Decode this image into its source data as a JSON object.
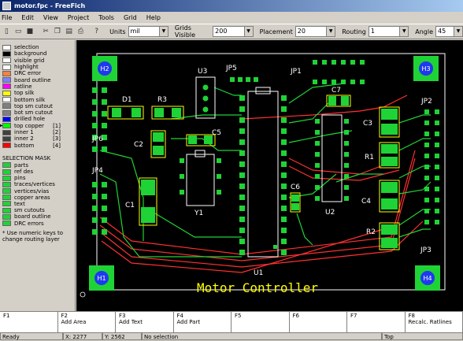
{
  "window": {
    "title": "motor.fpc - FreeFich"
  },
  "menu": [
    "File",
    "Edit",
    "View",
    "Project",
    "Tools",
    "Grid",
    "Help"
  ],
  "toolbar": {
    "units_label": "Units",
    "units_value": "mil",
    "grid_label": "Grids Visible",
    "grid_value": "200",
    "placement_label": "Placement",
    "placement_value": "20",
    "routing_label": "Routing",
    "routing_value": "1",
    "angle_label": "Angle",
    "angle_value": "45"
  },
  "layers": [
    {
      "label": "selection",
      "color": "#ffffff"
    },
    {
      "label": "background",
      "color": "#000000"
    },
    {
      "label": "visible grid",
      "color": "#ffffff"
    },
    {
      "label": "highlight",
      "color": "#ffffff"
    },
    {
      "label": "DRC error",
      "color": "#ff8040"
    },
    {
      "label": "board outline",
      "color": "#8080ff"
    },
    {
      "label": "ratline",
      "color": "#ff00ff"
    },
    {
      "label": "top silk",
      "color": "#ffff00"
    },
    {
      "label": "bottom silk",
      "color": "#ffffff"
    },
    {
      "label": "top sm cutout",
      "color": "#808080"
    },
    {
      "label": "bot sm cutout",
      "color": "#808080"
    },
    {
      "label": "drilled hole",
      "color": "#0000ff"
    },
    {
      "label": "top copper",
      "color": "#00ff00",
      "key": "[1]",
      "active": true
    },
    {
      "label": "inner 1",
      "color": "#404040",
      "key": "[2]"
    },
    {
      "label": "inner 2",
      "color": "#404040",
      "key": "[3]"
    },
    {
      "label": "bottom",
      "color": "#ff0000",
      "key": "[4]"
    }
  ],
  "selection_mask": {
    "title": "SELECTION MASK",
    "items": [
      "parts",
      "ref des",
      "pins",
      "traces/vertices",
      "vertices/vias",
      "copper areas",
      "text",
      "sm cutouts",
      "board outline",
      "DRC errors"
    ]
  },
  "hint": "* Use numeric keys to change routing layer",
  "board": {
    "title_text": "Motor Controller",
    "mounting_holes": [
      "H2",
      "H3",
      "H1",
      "H4"
    ],
    "refdes": [
      "U3",
      "JP5",
      "JP1",
      "D1",
      "R3",
      "C7",
      "JP2",
      "C3",
      "JP6",
      "C2",
      "C5",
      "R1",
      "JP4",
      "C6",
      "C4",
      "C1",
      "Y1",
      "U2",
      "R2",
      "JP3",
      "U1"
    ]
  },
  "fkeys": [
    {
      "num": "F1",
      "label": ""
    },
    {
      "num": "F2",
      "label": "Add Area"
    },
    {
      "num": "F3",
      "label": "Add Text"
    },
    {
      "num": "F4",
      "label": "Add Part"
    },
    {
      "num": "F5",
      "label": ""
    },
    {
      "num": "F6",
      "label": ""
    },
    {
      "num": "F7",
      "label": ""
    },
    {
      "num": "F8",
      "label": "Recalc. Ratlines"
    }
  ],
  "status": {
    "ready": "Ready",
    "x": "X: 2277",
    "y": "Y: 2562",
    "selection": "No selection",
    "layer": "Top"
  }
}
